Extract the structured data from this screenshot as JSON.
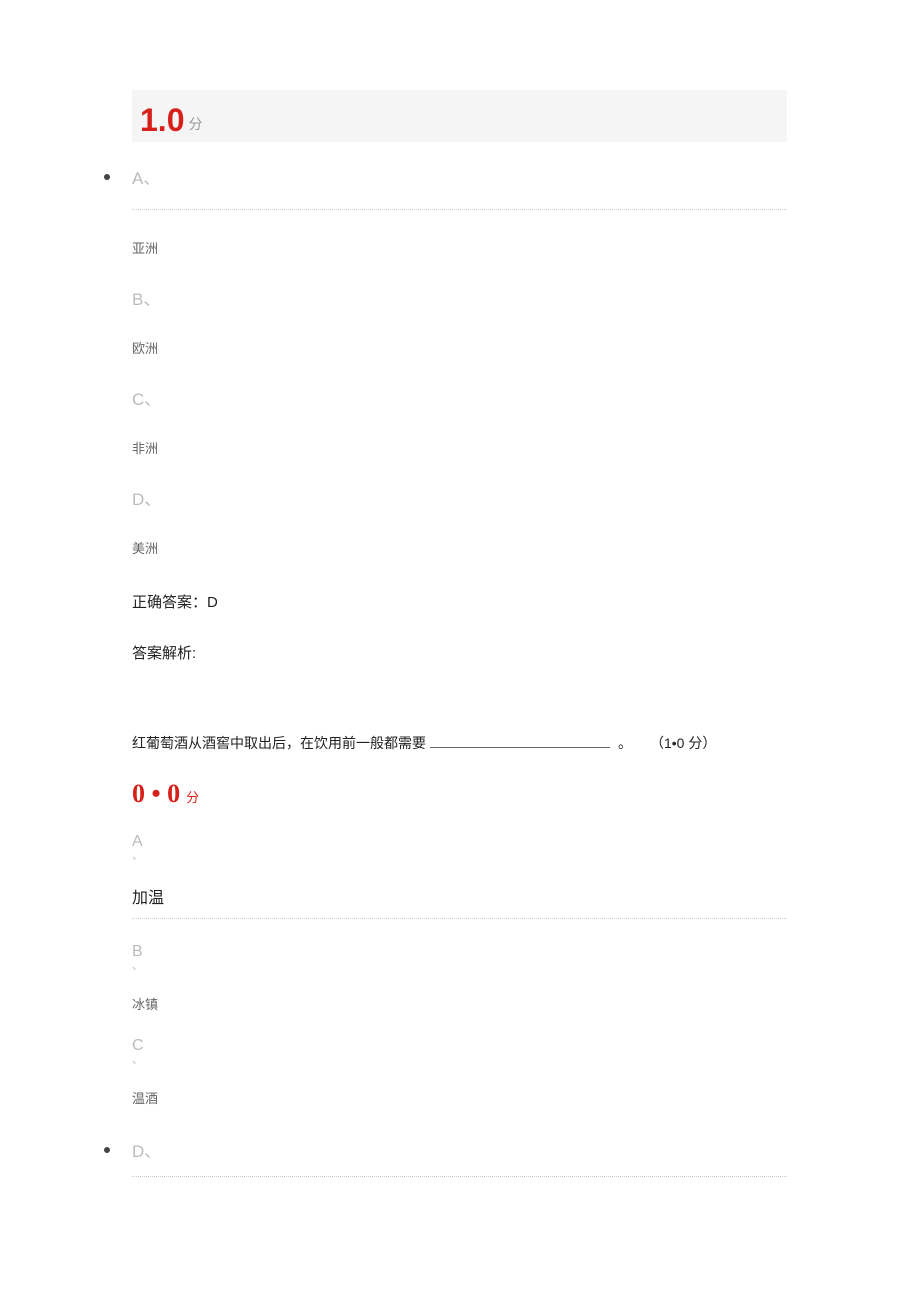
{
  "q1": {
    "score": "1.0",
    "score_unit": "分",
    "options": {
      "a_label": "A、",
      "a_text": "亚洲",
      "b_label": "B、",
      "b_text": "欧洲",
      "c_label": "C、",
      "c_text": "非洲",
      "d_label": "D、",
      "d_text": "美洲"
    },
    "correct_answer": "正确答案：D",
    "analysis_label": "答案解析:"
  },
  "q2": {
    "stem": "红葡萄酒从酒窖中取出后，在饮用前一般都需要",
    "period": "。",
    "points": "（1•0 分）",
    "score": "0 • 0",
    "score_unit": "分",
    "options": {
      "a_label": "A",
      "a_comma": "、",
      "a_text": "加温",
      "b_label": "B",
      "b_comma": "、",
      "b_text": "冰镇",
      "c_label": "C",
      "c_comma": "、",
      "c_text": "温酒",
      "d_label": "D、"
    }
  }
}
